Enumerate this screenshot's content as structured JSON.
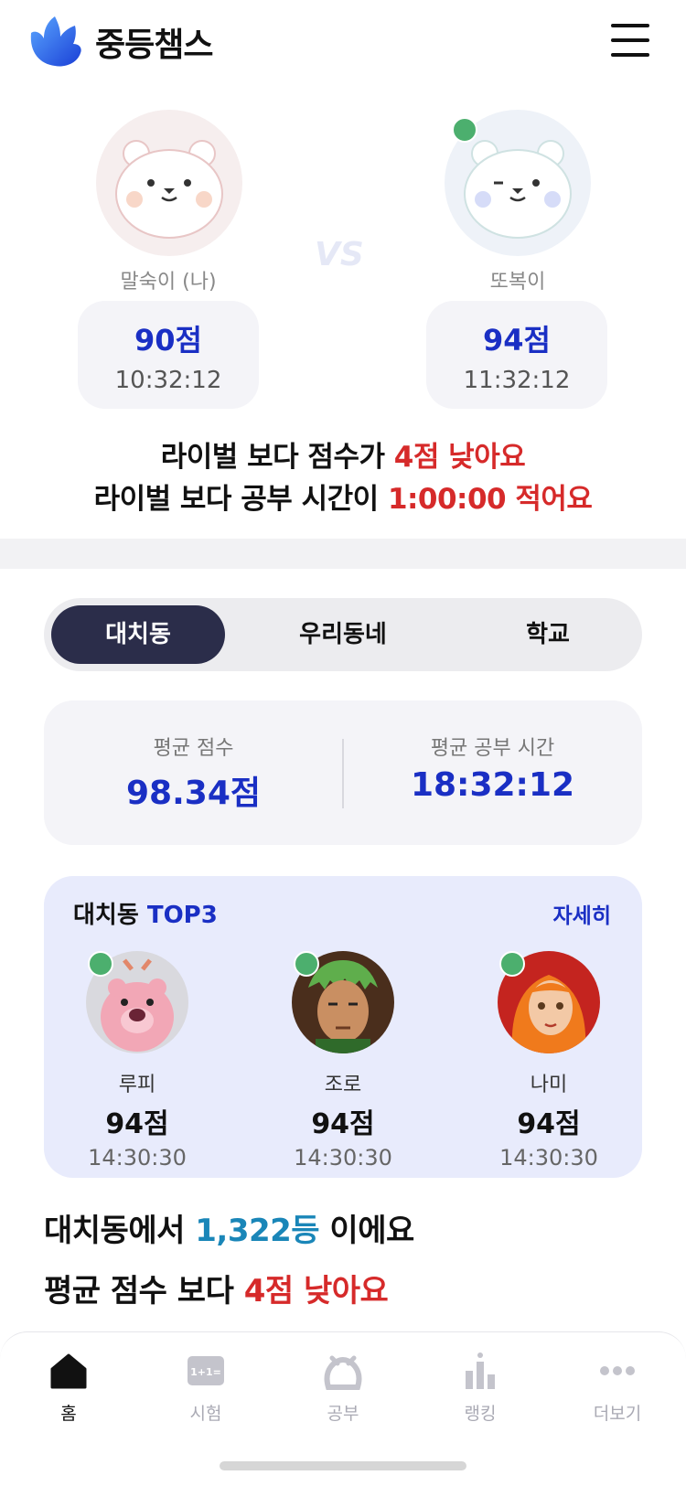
{
  "header": {
    "app_title": "중등챔스",
    "menu_icon": "hamburger-menu-icon"
  },
  "versus": {
    "vs_label": "VS",
    "me": {
      "name": "말숙이 (나)",
      "score": "90점",
      "time": "10:32:12"
    },
    "rival": {
      "name": "또복이",
      "score": "94점",
      "time": "11:32:12"
    },
    "compare_line1": {
      "prefix": "라이벌 보다 점수가 ",
      "highlight": "4점 낮아요"
    },
    "compare_line2": {
      "prefix": "라이벌 보다 공부 시간이 ",
      "highlight": "1:00:00 적어요"
    }
  },
  "tabs": [
    {
      "label": "대치동",
      "active": true
    },
    {
      "label": "우리동네",
      "active": false
    },
    {
      "label": "학교",
      "active": false
    }
  ],
  "averages": {
    "score_label": "평균 점수",
    "score_value": "98.34점",
    "time_label": "평균 공부 시간",
    "time_value": "18:32:12"
  },
  "top3": {
    "title": "대치동",
    "title_accent": "TOP3",
    "detail_label": "자세히",
    "rankers": [
      {
        "name": "루피",
        "score": "94점",
        "time": "14:30:30"
      },
      {
        "name": "조로",
        "score": "94점",
        "time": "14:30:30"
      },
      {
        "name": "나미",
        "score": "94점",
        "time": "14:30:30"
      }
    ]
  },
  "summary": {
    "line1": {
      "prefix": "대치동에서 ",
      "highlight": "1,322등",
      "suffix": " 이에요"
    },
    "line2": {
      "prefix": "평균 점수 보다 ",
      "highlight": "4점 낮아요"
    }
  },
  "bottom_nav": [
    {
      "label": "홈",
      "icon": "home-icon",
      "active": true
    },
    {
      "label": "시험",
      "icon": "exam-icon",
      "active": false
    },
    {
      "label": "공부",
      "icon": "study-icon",
      "active": false
    },
    {
      "label": "랭킹",
      "icon": "ranking-icon",
      "active": false
    },
    {
      "label": "더보기",
      "icon": "more-icon",
      "active": false
    }
  ],
  "colors": {
    "accent_blue": "#1a2fc4",
    "warning_red": "#d62a2a",
    "rank_blue": "#1a86b8",
    "online_green": "#4caf6e"
  }
}
